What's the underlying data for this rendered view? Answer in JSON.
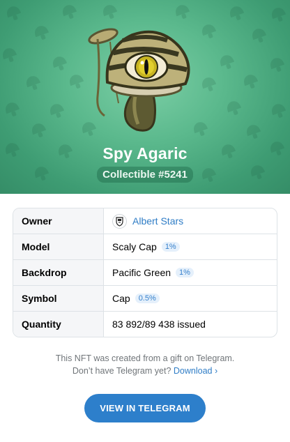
{
  "hero": {
    "title": "Spy Agaric",
    "subtitle": "Collectible #5241",
    "backdrop_colors": [
      "#7ccfa6",
      "#3e9c73"
    ],
    "pattern_icon": "mushroom-cap-icon",
    "image_icon": "spy-agaric-mushroom-eye-icon"
  },
  "attributes": [
    {
      "key": "Owner",
      "value": "Albert Stars",
      "icon": "owner-avatar-icon"
    },
    {
      "key": "Model",
      "value": "Scaly Cap",
      "rarity": "1%"
    },
    {
      "key": "Backdrop",
      "value": "Pacific Green",
      "rarity": "1%"
    },
    {
      "key": "Symbol",
      "value": "Cap",
      "rarity": "0.5%"
    },
    {
      "key": "Quantity",
      "value": "83 892/89 438 issued"
    }
  ],
  "info": {
    "line1": "This NFT was created from a gift on Telegram.",
    "line2": "Don’t have Telegram yet?",
    "download_label": "Download ›"
  },
  "cta": {
    "label": "VIEW IN TELEGRAM"
  },
  "colors": {
    "accent": "#2d7fcb",
    "link": "#2f7dc6",
    "badge_bg": "#e5f0fb"
  }
}
